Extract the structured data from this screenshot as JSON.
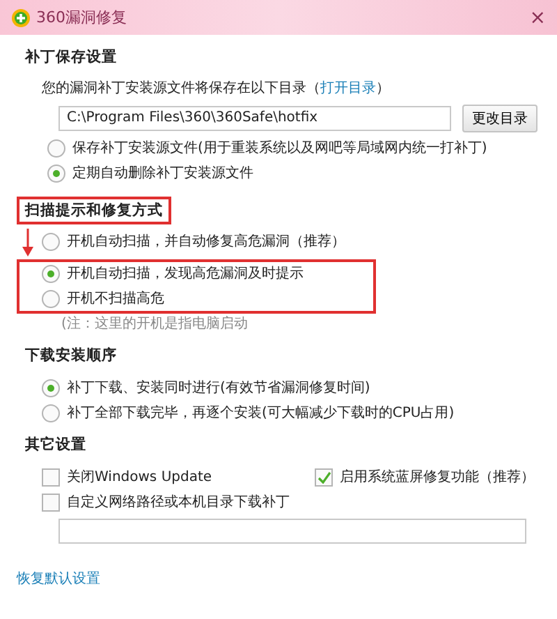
{
  "window": {
    "title": "360漏洞修复",
    "close": "×"
  },
  "patch_save": {
    "heading": "补丁保存设置",
    "description": "您的漏洞补丁安装源文件将保存在以下目录（",
    "link": "打开目录",
    "description_end": "）",
    "path": "C:\\Program Files\\360\\360Safe\\hotfix",
    "change_button": "更改目录",
    "options": [
      {
        "label": "保存补丁安装源文件(用于重装系统以及网吧等局域网内统一打补丁)",
        "selected": false
      },
      {
        "label": "定期自动删除补丁安装源文件",
        "selected": true
      }
    ]
  },
  "scan": {
    "heading": "扫描提示和修复方式",
    "heading_highlighted": true,
    "options": [
      {
        "label": "开机自动扫描，并自动修复高危漏洞（推荐）",
        "selected": false,
        "highlighted": false
      },
      {
        "label": "开机自动扫描，发现高危漏洞及时提示",
        "selected": true,
        "highlighted": true
      },
      {
        "label": "开机不扫描高危",
        "selected": false,
        "highlighted": true
      }
    ],
    "note": "(注：这里的开机是指电脑启动"
  },
  "download": {
    "heading": "下载安装顺序",
    "options": [
      {
        "label": "补丁下载、安装同时进行(有效节省漏洞修复时间)",
        "selected": true
      },
      {
        "label": "补丁全部下载完毕，再逐个安装(可大幅减少下载时的CPU占用)",
        "selected": false
      }
    ]
  },
  "other": {
    "heading": "其它设置",
    "checkboxes": [
      {
        "label": "关闭Windows Update",
        "checked": false
      },
      {
        "label": "启用系统蓝屏修复功能（推荐）",
        "checked": true
      },
      {
        "label": "自定义网络路径或本机目录下载补丁",
        "checked": false
      }
    ]
  },
  "restore_link": "恢复默认设置"
}
